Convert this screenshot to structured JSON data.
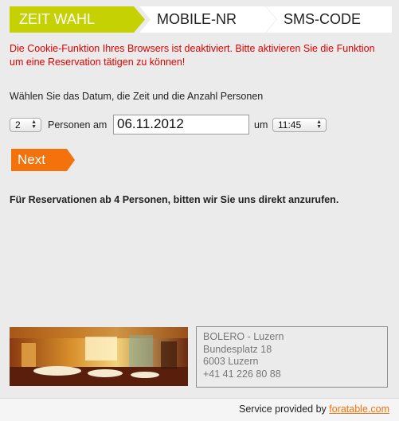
{
  "steps": [
    {
      "label": "ZEIT WAHL",
      "active": true
    },
    {
      "label": "MOBILE-NR",
      "active": false
    },
    {
      "label": "SMS-CODE",
      "active": false
    }
  ],
  "warning": "Die Cookie-Funktion Ihres Browsers ist deaktiviert. Bitte aktivieren Sie die Funktion um eine Reservation tätigen zu können!",
  "intro": "Wählen Sie das Datum, die Zeit und die Anzahl Personen",
  "form": {
    "persons_value": "2",
    "persons_label": "Personen am",
    "date_value": "06.11.2012",
    "um_label": "um",
    "time_value": "11:45"
  },
  "next_label": "Next",
  "note": "Für Reservationen ab 4 Personen, bitten wir Sie uns direkt anzurufen.",
  "address": {
    "name": "BOLERO - Luzern",
    "street": "Bundesplatz 18",
    "city": "6003 Luzern",
    "phone": "+41 41 226 80 88"
  },
  "footer": {
    "text": "Service provided by",
    "link": "foratable.com"
  },
  "colors": {
    "accent_green": "#c5d102",
    "accent_orange": "#f3720b",
    "warning_red": "#e00000"
  }
}
